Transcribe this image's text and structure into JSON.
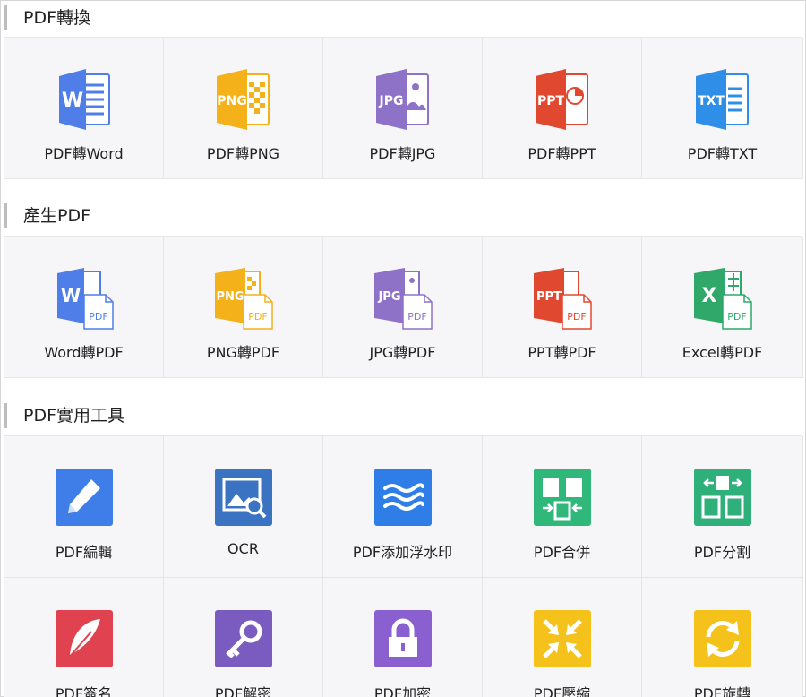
{
  "sections": [
    {
      "title": "PDF轉換",
      "items": [
        {
          "label": "PDF轉Word",
          "icon": "word-file-icon",
          "badge": "W",
          "color": "#4f7ee8"
        },
        {
          "label": "PDF轉PNG",
          "icon": "png-file-icon",
          "badge": "PNG",
          "color": "#f4b11a"
        },
        {
          "label": "PDF轉JPG",
          "icon": "jpg-file-icon",
          "badge": "JPG",
          "color": "#8d72c8"
        },
        {
          "label": "PDF轉PPT",
          "icon": "ppt-file-icon",
          "badge": "PPT",
          "color": "#e0492f"
        },
        {
          "label": "PDF轉TXT",
          "icon": "txt-file-icon",
          "badge": "TXT",
          "color": "#2f8fe8"
        }
      ]
    },
    {
      "title": "產生PDF",
      "items": [
        {
          "label": "Word轉PDF",
          "icon": "word-to-pdf-icon",
          "badge": "W",
          "tag": "PDF",
          "color": "#4f7ee8"
        },
        {
          "label": "PNG轉PDF",
          "icon": "png-to-pdf-icon",
          "badge": "PNG",
          "tag": "PDF",
          "color": "#f4b11a"
        },
        {
          "label": "JPG轉PDF",
          "icon": "jpg-to-pdf-icon",
          "badge": "JPG",
          "tag": "PDF",
          "color": "#8d72c8"
        },
        {
          "label": "PPT轉PDF",
          "icon": "ppt-to-pdf-icon",
          "badge": "PPT",
          "tag": "PDF",
          "color": "#e0492f"
        },
        {
          "label": "Excel轉PDF",
          "icon": "excel-to-pdf-icon",
          "badge": "X",
          "tag": "PDF",
          "color": "#2fa86a"
        }
      ]
    },
    {
      "title": "PDF實用工具",
      "items": [
        {
          "label": "PDF編輯",
          "icon": "pencil-edit-icon",
          "color": "#3f7ee8"
        },
        {
          "label": "OCR",
          "icon": "image-search-ocr-icon",
          "color": "#3a73c2"
        },
        {
          "label": "PDF添加浮水印",
          "icon": "watermark-waves-icon",
          "color": "#2f7ee8"
        },
        {
          "label": "PDF合併",
          "icon": "merge-pages-icon",
          "color": "#2fb87a"
        },
        {
          "label": "PDF分割",
          "icon": "split-pages-icon",
          "color": "#2fb07a"
        },
        {
          "label": "PDF簽名",
          "icon": "feather-sign-icon",
          "color": "#e0434f"
        },
        {
          "label": "PDF解密",
          "icon": "key-decrypt-icon",
          "color": "#7a5cc0"
        },
        {
          "label": "PDF加密",
          "icon": "lock-encrypt-icon",
          "color": "#8a60d0"
        },
        {
          "label": "PDF壓縮",
          "icon": "compress-arrows-icon",
          "color": "#f4c21a"
        },
        {
          "label": "PDF旋轉",
          "icon": "rotate-arrows-icon",
          "color": "#f4c21a"
        }
      ]
    }
  ]
}
